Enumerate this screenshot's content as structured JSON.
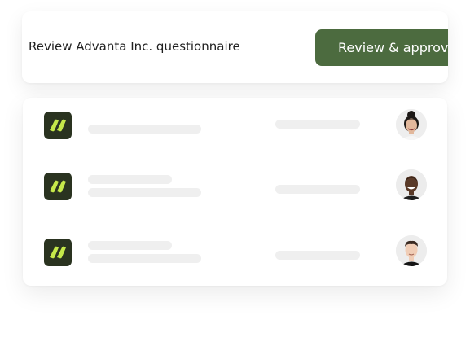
{
  "task": {
    "title": "Review Advanta Inc. questionnaire",
    "button_label": "Review & approve"
  },
  "colors": {
    "primary_button": "#4c6b3f",
    "logo_bg": "#2a3320",
    "logo_mark": "#c5e84a",
    "placeholder": "#efefef"
  },
  "list": {
    "rows": [
      {
        "logo_icon": "brand-logo-icon",
        "avatar": "woman-with-bun-avatar"
      },
      {
        "logo_icon": "brand-logo-icon",
        "avatar": "smiling-man-avatar"
      },
      {
        "logo_icon": "brand-logo-icon",
        "avatar": "man-with-short-hair-avatar"
      }
    ]
  }
}
